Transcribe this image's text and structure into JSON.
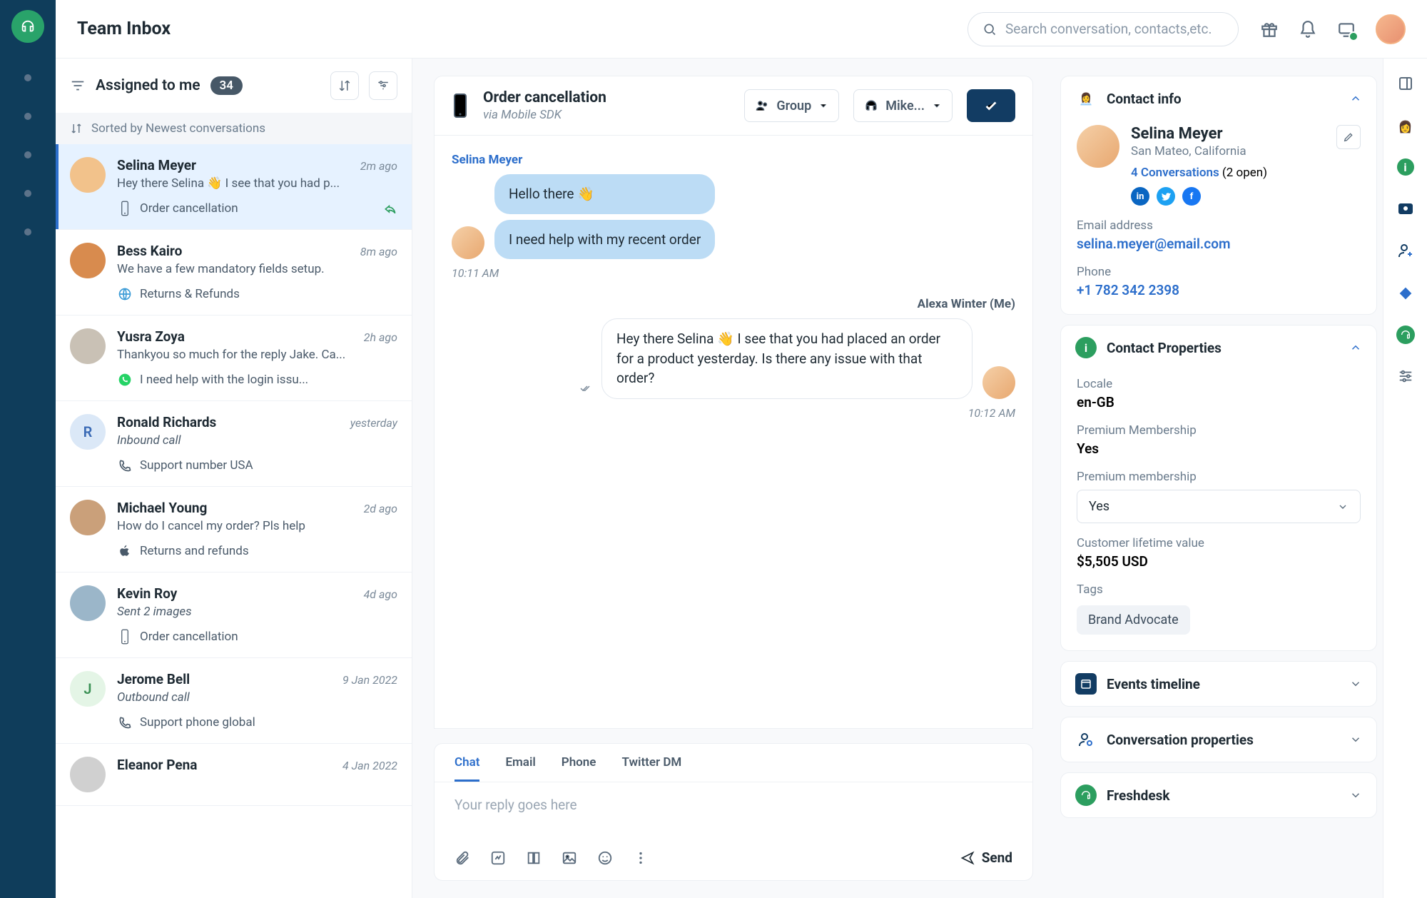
{
  "header": {
    "title": "Team Inbox",
    "search_placeholder": "Search conversation, contacts,etc."
  },
  "inbox": {
    "filter_label": "Assigned to me",
    "count": "34",
    "sort_label": "Sorted by Newest conversations",
    "items": [
      {
        "name": "Selina Meyer",
        "time": "2m ago",
        "preview": "Hey there Selina 👋 I see that you had p...",
        "channel": "Order cancellation",
        "channel_icon": "mobile",
        "active": true,
        "reply": true,
        "avatar_color": "#f2c28b"
      },
      {
        "name": "Bess Kairo",
        "time": "8m ago",
        "preview": "We have a few mandatory fields setup.",
        "channel": "Returns & Refunds",
        "channel_icon": "globe",
        "avatar_color": "#d88b4e"
      },
      {
        "name": "Yusra Zoya",
        "time": "2h ago",
        "preview": "Thankyou so much for the reply Jake. Ca...",
        "channel": "I need help with the login issu...",
        "channel_icon": "whatsapp",
        "avatar_color": "#c9c1b5"
      },
      {
        "name": "Ronald Richards",
        "time": "yesterday",
        "preview": "Inbound call",
        "italic": true,
        "channel": "Support number USA",
        "channel_icon": "phone",
        "initial": "R"
      },
      {
        "name": "Michael Young",
        "time": "2d ago",
        "preview": "How do I cancel my order? Pls help",
        "channel": "Returns and refunds",
        "channel_icon": "apple",
        "avatar_color": "#caa07a"
      },
      {
        "name": "Kevin Roy",
        "time": "4d ago",
        "preview": "Sent 2 images",
        "italic": true,
        "channel": "Order cancellation",
        "channel_icon": "mobile",
        "avatar_color": "#9bb6c9"
      },
      {
        "name": "Jerome Bell",
        "time": "9 Jan 2022",
        "preview": "Outbound call",
        "italic": true,
        "channel": "Support phone global",
        "channel_icon": "phone",
        "initial": "J",
        "avatar_bg": "#e4f5e6",
        "avatar_fg": "#3b9155"
      },
      {
        "name": "Eleanor Pena",
        "time": "4 Jan 2022",
        "preview": "",
        "channel": "",
        "channel_icon": ""
      }
    ]
  },
  "chat": {
    "title": "Order cancellation",
    "subtitle": "via Mobile SDK",
    "group_label": "Group",
    "assignee_label": "Mike...",
    "messages": [
      {
        "from": "Selina Meyer",
        "side": "customer",
        "bubbles": [
          "Hello there 👋",
          "I need help with my recent order"
        ],
        "time": "10:11 AM"
      },
      {
        "from": "Alexa Winter (Me)",
        "side": "agent",
        "bubbles": [
          "Hey there Selina 👋 I see that you had placed an order for a product yesterday. Is there any issue with that order?"
        ],
        "time": "10:12 AM"
      }
    ],
    "composer": {
      "tabs": [
        "Chat",
        "Email",
        "Phone",
        "Twitter DM"
      ],
      "placeholder": "Your reply goes here",
      "send_label": "Send"
    }
  },
  "contact": {
    "panel_title": "Contact info",
    "name": "Selina Meyer",
    "location": "San Mateo, California",
    "conversations_link": "4 Conversations",
    "conversations_extra": "(2 open)",
    "email_label": "Email address",
    "email": "selina.meyer@email.com",
    "phone_label": "Phone",
    "phone": "+1 782 342 2398",
    "properties_title": "Contact Properties",
    "locale_label": "Locale",
    "locale": "en-GB",
    "premium_label": "Premium Membership",
    "premium": "Yes",
    "premium_select_label": "Premium membership",
    "premium_select_value": "Yes",
    "clv_label": "Customer lifetime value",
    "clv": "$5,505 USD",
    "tags_label": "Tags",
    "tag": "Brand Advocate",
    "events_title": "Events timeline",
    "convo_props_title": "Conversation properties",
    "freshdesk_title": "Freshdesk"
  }
}
